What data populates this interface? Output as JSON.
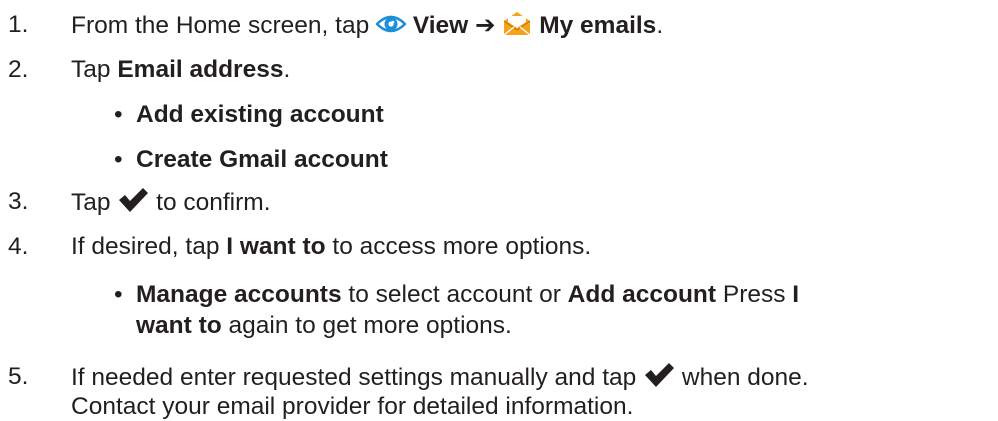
{
  "steps": [
    {
      "num": "1.",
      "parts": {
        "a": "From the Home screen, tap",
        "b": "View",
        "arrow": "➔",
        "c": "My emails",
        "d": "."
      },
      "icons": [
        "eye-icon",
        "envelope-icon"
      ]
    },
    {
      "num": "2.",
      "parts": {
        "a": "Tap ",
        "b": "Email address",
        "c": "."
      },
      "bullets": [
        "Add existing account",
        "Create Gmail account"
      ]
    },
    {
      "num": "3.",
      "parts": {
        "a": "Tap",
        "b": " to confirm."
      },
      "icons": [
        "checkmark-icon"
      ]
    },
    {
      "num": "4.",
      "parts": {
        "a": "If desired, tap ",
        "b": "I want to",
        "c": " to access more options."
      },
      "bullet": {
        "b1": "Manage accounts",
        "t1": " to select account or ",
        "b2": "Add account",
        "t2": " Press ",
        "b3": "I",
        "b4": "want to",
        "t3": " again to get more options."
      }
    },
    {
      "num": "5.",
      "parts": {
        "a": "If needed enter requested settings manually and tap",
        "b": " when done.",
        "c": "Contact your email provider for detailed information."
      },
      "icons": [
        "checkmark-icon"
      ]
    }
  ],
  "bullet_char": "•",
  "colors": {
    "text": "#231f20",
    "eye_blue": "#1b8fd8",
    "envelope_orange": "#f7a21b",
    "check": "#231f20"
  }
}
